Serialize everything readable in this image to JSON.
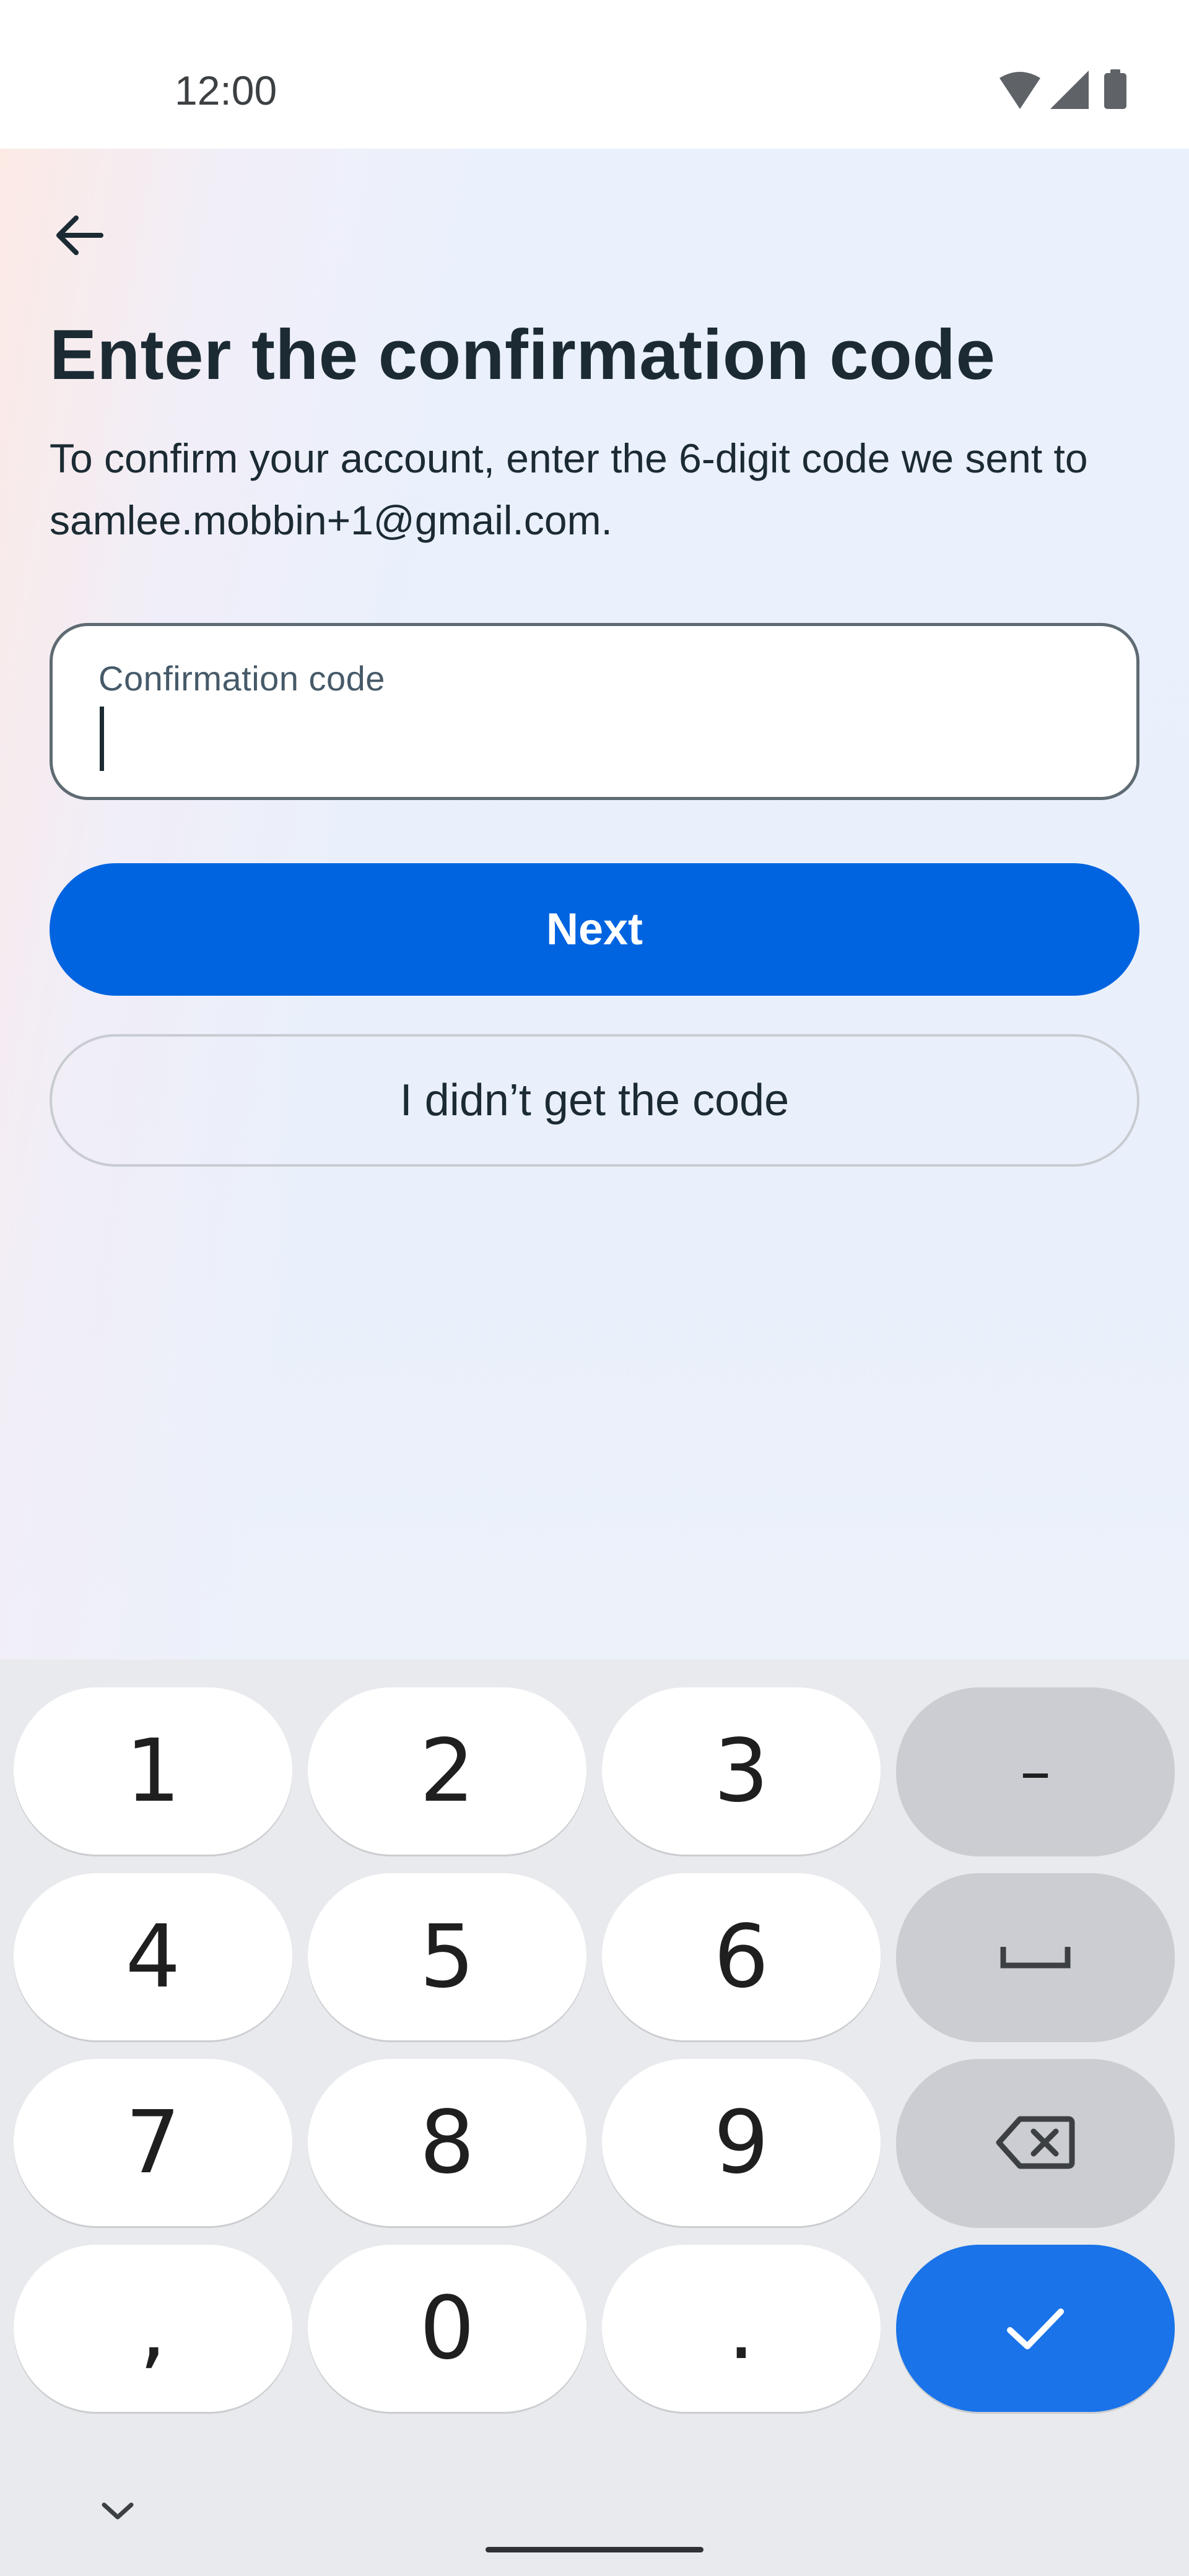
{
  "status_bar": {
    "time": "12:00",
    "icons": [
      "wifi-icon",
      "cellular-signal-icon",
      "battery-icon"
    ]
  },
  "header": {
    "back_icon": "arrow-left-icon"
  },
  "main": {
    "title": "Enter the confirmation code",
    "description": "To confirm your account, enter the 6-digit code we sent to samlee.mobbin+1@gmail.com.",
    "code_field": {
      "label": "Confirmation code",
      "value": ""
    },
    "next_button": "Next",
    "no_code_button": "I didn’t get the code"
  },
  "keyboard": {
    "keys": {
      "k1": "1",
      "k2": "2",
      "k3": "3",
      "dash": "–",
      "k4": "4",
      "k5": "5",
      "k6": "6",
      "k7": "7",
      "k8": "8",
      "k9": "9",
      "comma": ",",
      "k0": "0",
      "period": "."
    },
    "special_icons": [
      "space-icon",
      "backspace-icon",
      "checkmark-icon",
      "chevron-down-icon"
    ]
  },
  "colors": {
    "primary": "#0064e0",
    "title_text": "#1c2b33",
    "keyboard_bg": "#e8eaed",
    "enter_key": "#1a73e8"
  }
}
